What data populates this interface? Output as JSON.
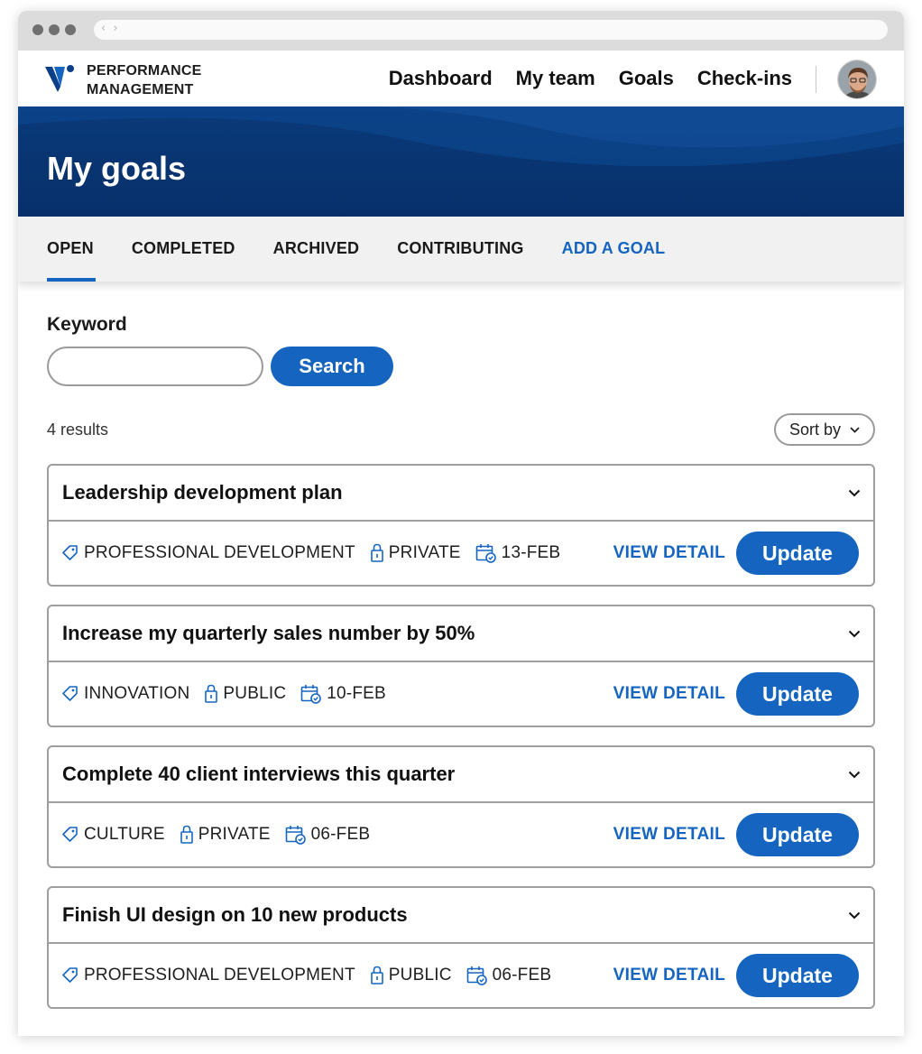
{
  "brand": {
    "line1": "PERFORMANCE",
    "line2": "MANAGEMENT"
  },
  "nav": {
    "items": [
      "Dashboard",
      "My team",
      "Goals",
      "Check-ins"
    ]
  },
  "page": {
    "title": "My goals"
  },
  "tabs": [
    {
      "label": "OPEN",
      "active": true
    },
    {
      "label": "COMPLETED",
      "active": false
    },
    {
      "label": "ARCHIVED",
      "active": false
    },
    {
      "label": "CONTRIBUTING",
      "active": false
    },
    {
      "label": "ADD A GOAL",
      "active": false
    }
  ],
  "search": {
    "label": "Keyword",
    "value": "",
    "button": "Search"
  },
  "results": {
    "count_text": "4 results",
    "sort_label": "Sort by"
  },
  "goals": [
    {
      "title": "Leadership development plan",
      "category": "PROFESSIONAL DEVELOPMENT",
      "visibility": "PRIVATE",
      "date": "13-FEB",
      "view_label": "VIEW DETAIL",
      "update_label": "Update"
    },
    {
      "title": "Increase my quarterly sales number by 50%",
      "category": "INNOVATION",
      "visibility": "PUBLIC",
      "date": "10-FEB",
      "view_label": "VIEW DETAIL",
      "update_label": "Update"
    },
    {
      "title": "Complete 40 client interviews this quarter",
      "category": "CULTURE",
      "visibility": "PRIVATE",
      "date": "06-FEB",
      "view_label": "VIEW DETAIL",
      "update_label": "Update"
    },
    {
      "title": "Finish UI design on 10 new products",
      "category": "PROFESSIONAL DEVELOPMENT",
      "visibility": "PUBLIC",
      "date": "06-FEB",
      "view_label": "VIEW DETAIL",
      "update_label": "Update"
    }
  ],
  "colors": {
    "accent": "#1565c0",
    "hero": "#07306a",
    "tab_bar": "#f1f1f1",
    "border": "#9e9e9e"
  },
  "icons": {
    "category": "tag-icon",
    "visibility": "lock-icon",
    "date": "calendar-check-icon",
    "expand": "chevron-down-icon"
  }
}
